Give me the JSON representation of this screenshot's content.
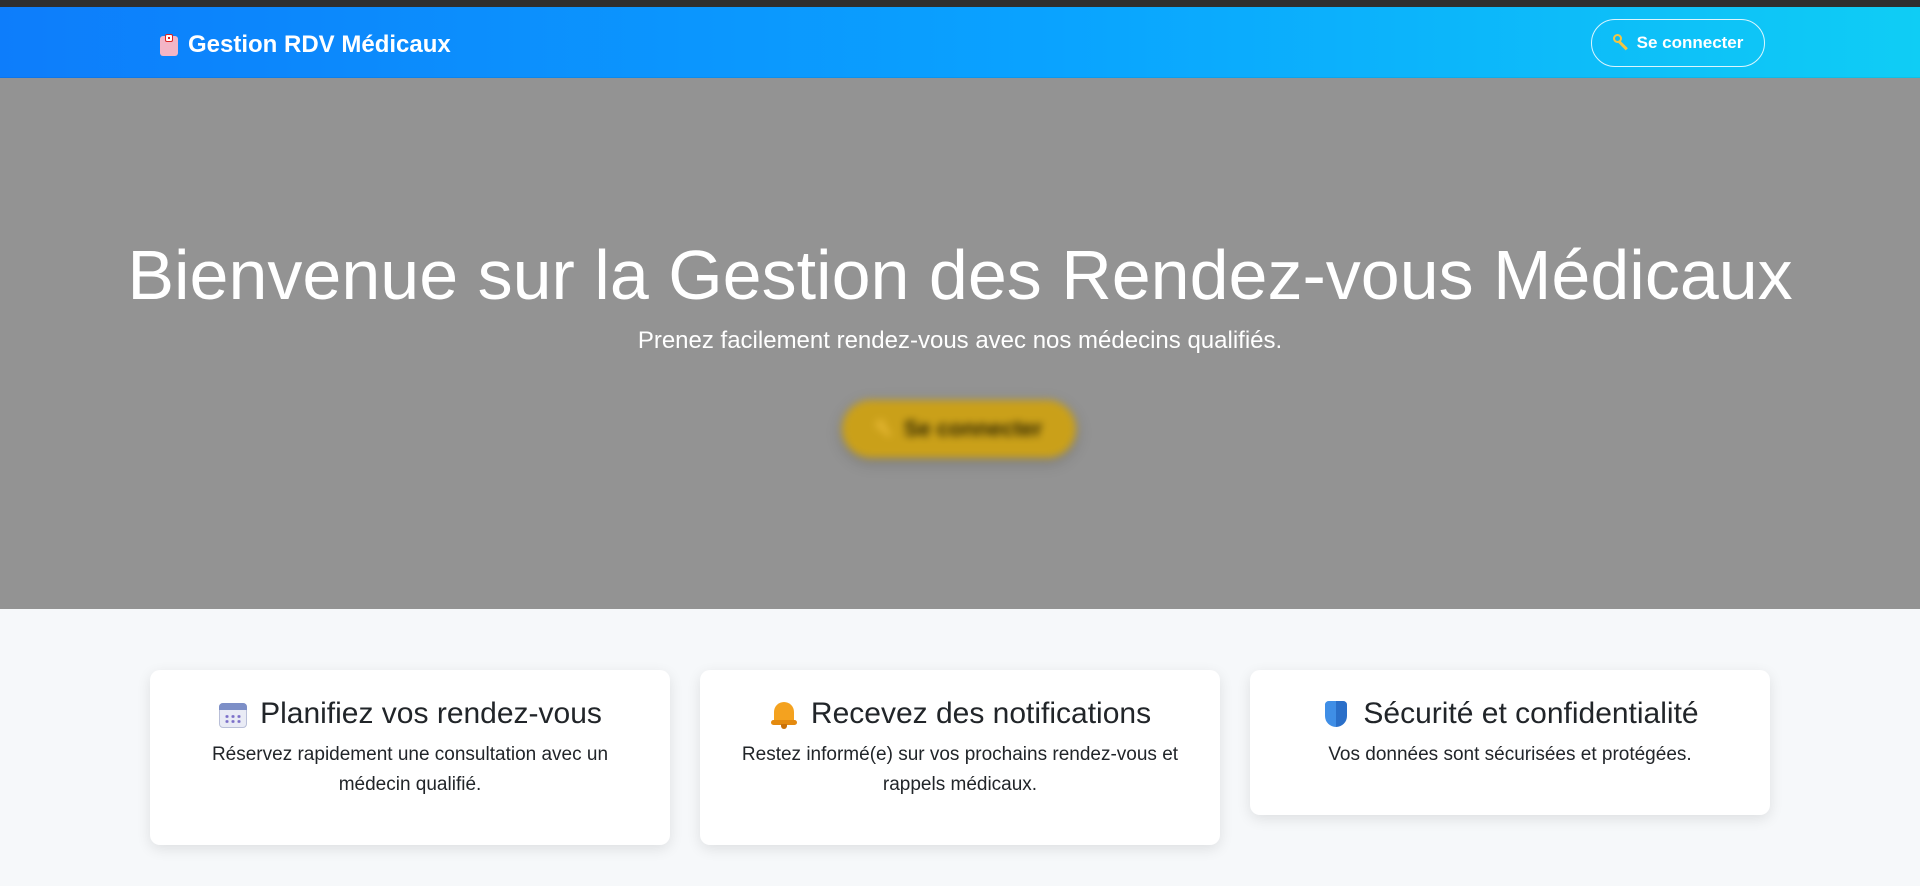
{
  "navbar": {
    "brand": {
      "icon": "hospital-icon",
      "label": "Gestion RDV Médicaux"
    },
    "login_button": {
      "icon": "key-icon",
      "label": "Se connecter"
    }
  },
  "hero": {
    "title": "Bienvenue sur la Gestion des Rendez-vous Médicaux",
    "subtitle": "Prenez facilement rendez-vous avec nos médecins qualifiés.",
    "cta": {
      "icon": "key-icon",
      "label": "Se connecter"
    }
  },
  "features": [
    {
      "icon": "calendar-icon",
      "title": "Planifiez vos rendez-vous",
      "text": "Réservez rapidement une consultation avec un médecin qualifié."
    },
    {
      "icon": "bell-icon",
      "title": "Recevez des notifications",
      "text": "Restez informé(e) sur vos prochains rendez-vous et rappels médicaux."
    },
    {
      "icon": "shield-icon",
      "title": "Sécurité et confidentialité",
      "text": "Vos données sont sécurisées et protégées."
    }
  ],
  "colors": {
    "navbar_gradient_start": "#0d7dfb",
    "navbar_gradient_end": "#0fcdf5",
    "hero_overlay": "#939393",
    "cta_yellow": "#caa019",
    "page_background": "#f6f8fa"
  }
}
